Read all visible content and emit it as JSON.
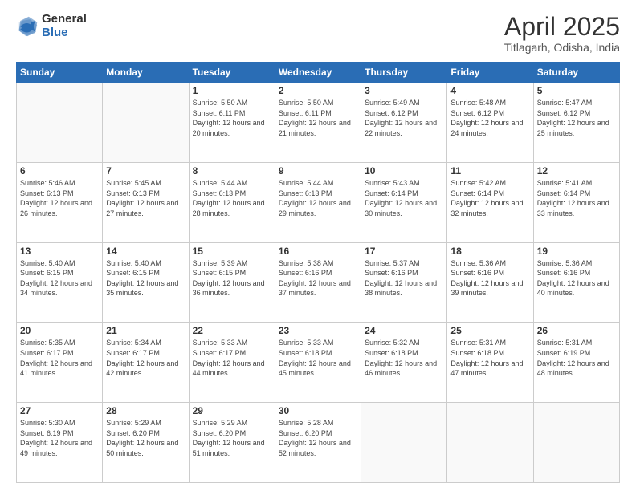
{
  "logo": {
    "general": "General",
    "blue": "Blue"
  },
  "header": {
    "title": "April 2025",
    "subtitle": "Titlagarh, Odisha, India"
  },
  "weekdays": [
    "Sunday",
    "Monday",
    "Tuesday",
    "Wednesday",
    "Thursday",
    "Friday",
    "Saturday"
  ],
  "weeks": [
    [
      {
        "day": "",
        "info": ""
      },
      {
        "day": "",
        "info": ""
      },
      {
        "day": "1",
        "info": "Sunrise: 5:50 AM\nSunset: 6:11 PM\nDaylight: 12 hours and 20 minutes."
      },
      {
        "day": "2",
        "info": "Sunrise: 5:50 AM\nSunset: 6:11 PM\nDaylight: 12 hours and 21 minutes."
      },
      {
        "day": "3",
        "info": "Sunrise: 5:49 AM\nSunset: 6:12 PM\nDaylight: 12 hours and 22 minutes."
      },
      {
        "day": "4",
        "info": "Sunrise: 5:48 AM\nSunset: 6:12 PM\nDaylight: 12 hours and 24 minutes."
      },
      {
        "day": "5",
        "info": "Sunrise: 5:47 AM\nSunset: 6:12 PM\nDaylight: 12 hours and 25 minutes."
      }
    ],
    [
      {
        "day": "6",
        "info": "Sunrise: 5:46 AM\nSunset: 6:13 PM\nDaylight: 12 hours and 26 minutes."
      },
      {
        "day": "7",
        "info": "Sunrise: 5:45 AM\nSunset: 6:13 PM\nDaylight: 12 hours and 27 minutes."
      },
      {
        "day": "8",
        "info": "Sunrise: 5:44 AM\nSunset: 6:13 PM\nDaylight: 12 hours and 28 minutes."
      },
      {
        "day": "9",
        "info": "Sunrise: 5:44 AM\nSunset: 6:13 PM\nDaylight: 12 hours and 29 minutes."
      },
      {
        "day": "10",
        "info": "Sunrise: 5:43 AM\nSunset: 6:14 PM\nDaylight: 12 hours and 30 minutes."
      },
      {
        "day": "11",
        "info": "Sunrise: 5:42 AM\nSunset: 6:14 PM\nDaylight: 12 hours and 32 minutes."
      },
      {
        "day": "12",
        "info": "Sunrise: 5:41 AM\nSunset: 6:14 PM\nDaylight: 12 hours and 33 minutes."
      }
    ],
    [
      {
        "day": "13",
        "info": "Sunrise: 5:40 AM\nSunset: 6:15 PM\nDaylight: 12 hours and 34 minutes."
      },
      {
        "day": "14",
        "info": "Sunrise: 5:40 AM\nSunset: 6:15 PM\nDaylight: 12 hours and 35 minutes."
      },
      {
        "day": "15",
        "info": "Sunrise: 5:39 AM\nSunset: 6:15 PM\nDaylight: 12 hours and 36 minutes."
      },
      {
        "day": "16",
        "info": "Sunrise: 5:38 AM\nSunset: 6:16 PM\nDaylight: 12 hours and 37 minutes."
      },
      {
        "day": "17",
        "info": "Sunrise: 5:37 AM\nSunset: 6:16 PM\nDaylight: 12 hours and 38 minutes."
      },
      {
        "day": "18",
        "info": "Sunrise: 5:36 AM\nSunset: 6:16 PM\nDaylight: 12 hours and 39 minutes."
      },
      {
        "day": "19",
        "info": "Sunrise: 5:36 AM\nSunset: 6:16 PM\nDaylight: 12 hours and 40 minutes."
      }
    ],
    [
      {
        "day": "20",
        "info": "Sunrise: 5:35 AM\nSunset: 6:17 PM\nDaylight: 12 hours and 41 minutes."
      },
      {
        "day": "21",
        "info": "Sunrise: 5:34 AM\nSunset: 6:17 PM\nDaylight: 12 hours and 42 minutes."
      },
      {
        "day": "22",
        "info": "Sunrise: 5:33 AM\nSunset: 6:17 PM\nDaylight: 12 hours and 44 minutes."
      },
      {
        "day": "23",
        "info": "Sunrise: 5:33 AM\nSunset: 6:18 PM\nDaylight: 12 hours and 45 minutes."
      },
      {
        "day": "24",
        "info": "Sunrise: 5:32 AM\nSunset: 6:18 PM\nDaylight: 12 hours and 46 minutes."
      },
      {
        "day": "25",
        "info": "Sunrise: 5:31 AM\nSunset: 6:18 PM\nDaylight: 12 hours and 47 minutes."
      },
      {
        "day": "26",
        "info": "Sunrise: 5:31 AM\nSunset: 6:19 PM\nDaylight: 12 hours and 48 minutes."
      }
    ],
    [
      {
        "day": "27",
        "info": "Sunrise: 5:30 AM\nSunset: 6:19 PM\nDaylight: 12 hours and 49 minutes."
      },
      {
        "day": "28",
        "info": "Sunrise: 5:29 AM\nSunset: 6:20 PM\nDaylight: 12 hours and 50 minutes."
      },
      {
        "day": "29",
        "info": "Sunrise: 5:29 AM\nSunset: 6:20 PM\nDaylight: 12 hours and 51 minutes."
      },
      {
        "day": "30",
        "info": "Sunrise: 5:28 AM\nSunset: 6:20 PM\nDaylight: 12 hours and 52 minutes."
      },
      {
        "day": "",
        "info": ""
      },
      {
        "day": "",
        "info": ""
      },
      {
        "day": "",
        "info": ""
      }
    ]
  ]
}
